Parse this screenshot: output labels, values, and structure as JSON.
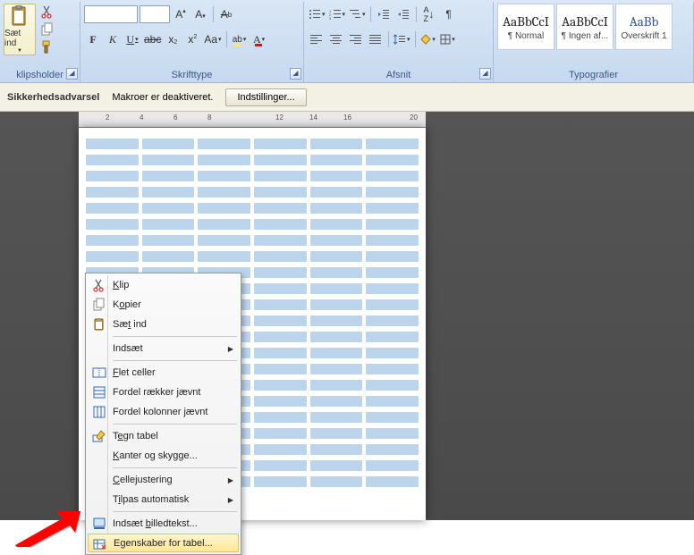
{
  "ribbon": {
    "clipboard": {
      "paste": "Sæt ind",
      "label": "klipsholder"
    },
    "font": {
      "label": "Skrifttype"
    },
    "para": {
      "label": "Afsnit"
    },
    "styles": {
      "label": "Typografier",
      "items": [
        {
          "sample": "AaBbCcI",
          "name": "¶ Normal"
        },
        {
          "sample": "AaBbCcI",
          "name": "¶ Ingen af..."
        },
        {
          "sample": "AaBb",
          "name": "Overskrift 1"
        }
      ]
    }
  },
  "security": {
    "title": "Sikkerhedsadvarsel",
    "msg": "Makroer er deaktiveret.",
    "button": "Indstillinger..."
  },
  "ruler": {
    "marks": [
      "2",
      "4",
      "6",
      "8",
      "12",
      "14",
      "16",
      "20"
    ]
  },
  "ctx": {
    "cut": "Klip",
    "copy": "Kopier",
    "paste": "Sæt ind",
    "insert": "Indsæt",
    "merge": "Flet celler",
    "distrows": "Fordel rækker jævnt",
    "distcols": "Fordel kolonner jævnt",
    "draw": "Tegn tabel",
    "borders": "Kanter og skygge...",
    "align": "Cellejustering",
    "autofit": "Tilpas automatisk",
    "caption": "Indsæt billedtekst...",
    "props": "Egenskaber for tabel..."
  }
}
